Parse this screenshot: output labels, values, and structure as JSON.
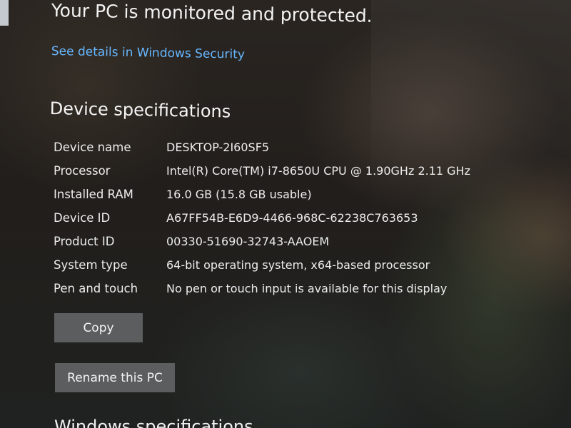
{
  "security": {
    "status_title": "Your PC is monitored and protected.",
    "details_link": "See details in Windows Security"
  },
  "device_specs": {
    "section_title": "Device specifications",
    "rows": [
      {
        "label": "Device name",
        "value": "DESKTOP-2I60SF5"
      },
      {
        "label": "Processor",
        "value": "Intel(R) Core(TM) i7-8650U CPU @ 1.90GHz   2.11 GHz"
      },
      {
        "label": "Installed RAM",
        "value": "16.0 GB (15.8 GB usable)"
      },
      {
        "label": "Device ID",
        "value": "A67FF54B-E6D9-4466-968C-62238C763653"
      },
      {
        "label": "Product ID",
        "value": "00330-51690-32743-AAOEM"
      },
      {
        "label": "System type",
        "value": "64-bit operating system, x64-based processor"
      },
      {
        "label": "Pen and touch",
        "value": "No pen or touch input is available for this display"
      }
    ],
    "copy_button": "Copy",
    "rename_button": "Rename this PC"
  },
  "windows_specs": {
    "section_title_partial": "Windows specifications"
  },
  "colors": {
    "link": "#66b7ff",
    "button_bg": "#5b5d5e",
    "text": "#f2f2f2"
  }
}
